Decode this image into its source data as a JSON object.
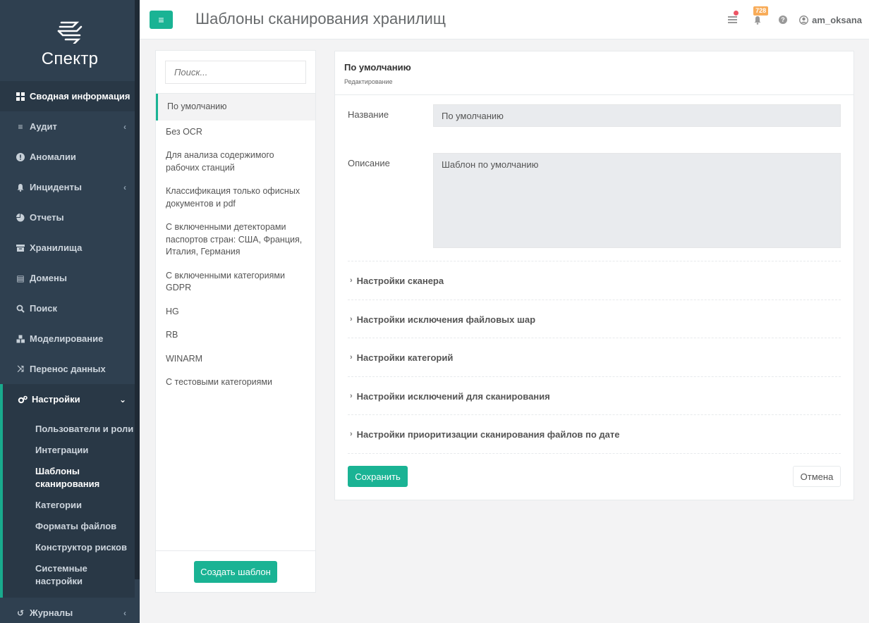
{
  "app": {
    "logo_text": "Спектр"
  },
  "header": {
    "title": "Шаблоны сканирования хранилищ",
    "notification_count": "728",
    "username": "am_oksana"
  },
  "sidebar": {
    "items": [
      {
        "label": "Сводная информация",
        "icon": "dashboard-icon"
      },
      {
        "label": "Аудит",
        "icon": "list-icon"
      },
      {
        "label": "Аномалии",
        "icon": "exclamation-icon"
      },
      {
        "label": "Инциденты",
        "icon": "bell-icon"
      },
      {
        "label": "Отчеты",
        "icon": "pie-chart-icon"
      },
      {
        "label": "Хранилища",
        "icon": "archive-icon"
      },
      {
        "label": "Домены",
        "icon": "server-icon"
      },
      {
        "label": "Поиск",
        "icon": "search-icon"
      },
      {
        "label": "Моделирование",
        "icon": "cubes-icon"
      },
      {
        "label": "Перенос данных",
        "icon": "shuffle-icon"
      },
      {
        "label": "Настройки",
        "icon": "gears-icon"
      }
    ],
    "settings_sub": [
      "Пользователи и роли",
      "Интеграции",
      "Шаблоны сканирования",
      "Категории",
      "Форматы файлов",
      "Конструктор рисков",
      "Системные настройки"
    ],
    "after": [
      {
        "label": "Журналы",
        "icon": "history-icon"
      }
    ]
  },
  "templates": {
    "search_placeholder": "Поиск...",
    "items": [
      "По умолчанию",
      "Без OCR",
      "Для анализа содержимого рабочих станций",
      "Классификация только офисных документов и pdf",
      "С включенными детекторами паспортов стран: США, Франция, Италия, Германия",
      "С включенными категориями GDPR",
      "HG",
      "RB",
      "WINARM",
      "С тестовыми категориями"
    ],
    "create_label": "Создать шаблон"
  },
  "detail": {
    "title": "По умолчанию",
    "subtitle": "Редактирование",
    "name_label": "Название",
    "name_value": "По умолчанию",
    "desc_label": "Описание",
    "desc_value": "Шаблон по умолчанию",
    "sections": [
      "Настройки сканера",
      "Настройки исключения файловых шар",
      "Настройки категорий",
      "Настройки исключений для сканирования",
      "Настройки приоритизации сканирования файлов по дате"
    ],
    "save_label": "Сохранить",
    "cancel_label": "Отмена"
  },
  "colors": {
    "accent": "#1ab394",
    "sidebar_bg": "#2f4050",
    "badge": "#f8ac59",
    "alert_dot": "#ed5565"
  }
}
